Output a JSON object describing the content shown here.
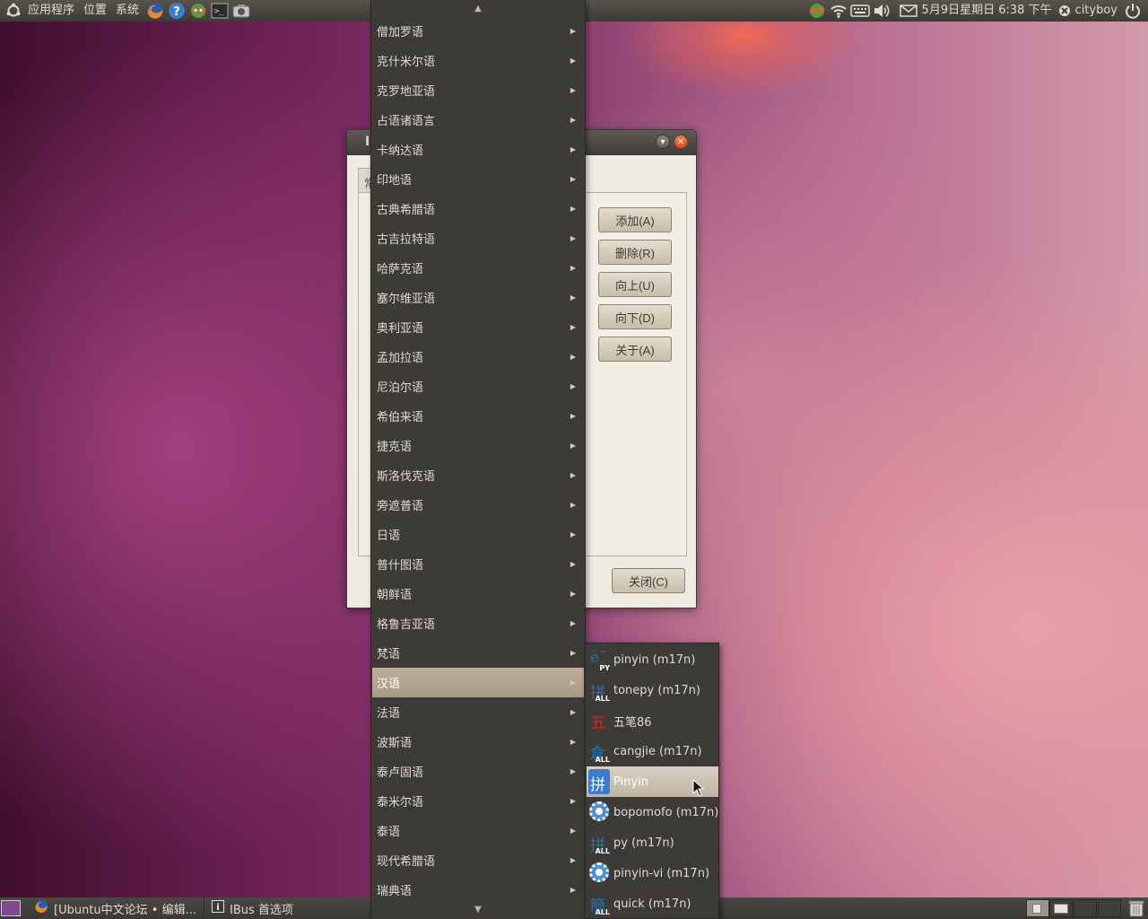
{
  "top_panel": {
    "menus": [
      "应用程序",
      "位置",
      "系统"
    ],
    "launchers": [
      "firefox-icon",
      "help-icon",
      "bandwidth-icon",
      "terminal-icon",
      "screenshot-icon"
    ],
    "clock": "5月9日星期日 6:38 下午",
    "user": "cityboy"
  },
  "dialog": {
    "title_fragment": "I",
    "tab_fragment": "常",
    "buttons": {
      "add": "添加(A)",
      "remove": "删除(R)",
      "up": "向上(U)",
      "down": "向下(D)",
      "about": "关于(A)"
    },
    "close": "关闭(C)"
  },
  "language_menu": {
    "scroll_up": "▲",
    "scroll_down": "▼",
    "items": [
      {
        "label": "僧加罗语"
      },
      {
        "label": "克什米尔语"
      },
      {
        "label": "克罗地亚语"
      },
      {
        "label": "占语诸语言"
      },
      {
        "label": "卡纳达语"
      },
      {
        "label": "印地语"
      },
      {
        "label": "古典希腊语"
      },
      {
        "label": "古吉拉特语"
      },
      {
        "label": "哈萨克语"
      },
      {
        "label": "塞尔维亚语"
      },
      {
        "label": "奥利亚语"
      },
      {
        "label": "孟加拉语"
      },
      {
        "label": "尼泊尔语"
      },
      {
        "label": "希伯来语"
      },
      {
        "label": "捷克语"
      },
      {
        "label": "斯洛伐克语"
      },
      {
        "label": "旁遮普语"
      },
      {
        "label": "日语"
      },
      {
        "label": "普什图语"
      },
      {
        "label": "朝鲜语"
      },
      {
        "label": "格鲁吉亚语"
      },
      {
        "label": "梵语"
      },
      {
        "label": "汉语",
        "highlighted": true
      },
      {
        "label": "法语"
      },
      {
        "label": "波斯语"
      },
      {
        "label": "泰卢固语"
      },
      {
        "label": "泰米尔语"
      },
      {
        "label": "泰语"
      },
      {
        "label": "现代希腊语"
      },
      {
        "label": "瑞典语"
      }
    ]
  },
  "ime_menu": {
    "items": [
      {
        "label": "pinyin (m17n)",
        "icon": "m17n-pinyin-icon",
        "glyph": "è¨",
        "tag": "PY"
      },
      {
        "label": "tonepy (m17n)",
        "icon": "m17n-tonepy-icon",
        "glyph": "拼",
        "tag": "ALL"
      },
      {
        "label": "五笔86",
        "icon": "wubi-icon",
        "glyph": "五",
        "tag": ""
      },
      {
        "label": "cangjie (m17n)",
        "icon": "m17n-cangjie-icon",
        "glyph": "倉",
        "tag": "ALL"
      },
      {
        "label": "Pinyin",
        "icon": "ibus-pinyin-icon",
        "glyph": "拼",
        "tag": "",
        "highlighted": true
      },
      {
        "label": "bopomofo (m17n)",
        "icon": "gear-icon",
        "glyph": "",
        "tag": ""
      },
      {
        "label": "py (m17n)",
        "icon": "m17n-py-icon",
        "glyph": "拼",
        "tag": "ALL"
      },
      {
        "label": "pinyin-vi (m17n)",
        "icon": "gear-icon",
        "glyph": "",
        "tag": ""
      },
      {
        "label": "quick (m17n)",
        "icon": "m17n-quick-icon",
        "glyph": "簡",
        "tag": "ALL"
      }
    ]
  },
  "taskbar": {
    "tasks": [
      "[Ubuntu中文论坛 • 编辑...",
      "IBus 首选项"
    ]
  },
  "colors": {
    "panel": "#3c3b37",
    "menu_highlight": "#a89a84",
    "close_button": "#e0602e"
  }
}
